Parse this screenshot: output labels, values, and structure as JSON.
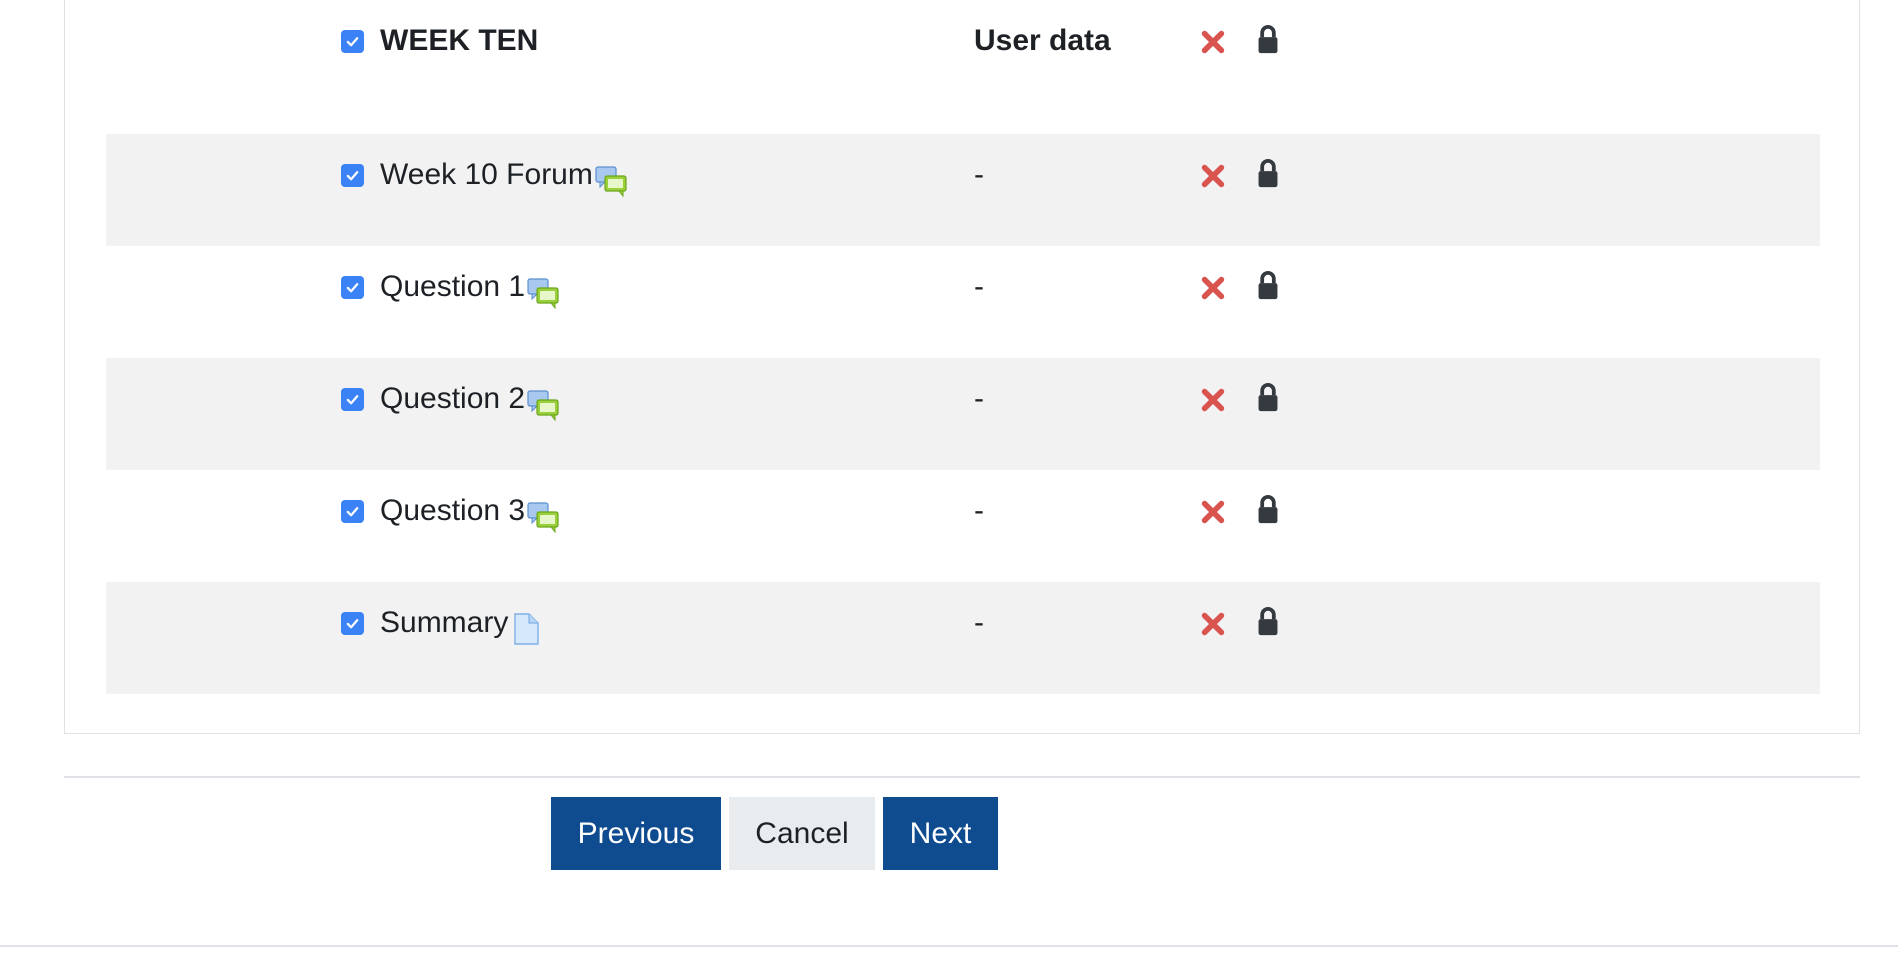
{
  "section": {
    "title": "WEEK TEN",
    "userdata_header": "User data",
    "checked": true
  },
  "activities": [
    {
      "name": "Week 10 Forum",
      "icon": "forum-icon",
      "userdata": "-",
      "checked": true
    },
    {
      "name": "Question 1",
      "icon": "forum-icon",
      "userdata": "-",
      "checked": true
    },
    {
      "name": "Question 2",
      "icon": "forum-icon",
      "userdata": "-",
      "checked": true
    },
    {
      "name": "Question 3",
      "icon": "forum-icon",
      "userdata": "-",
      "checked": true
    },
    {
      "name": "Summary",
      "icon": "page-icon",
      "userdata": "-",
      "checked": true
    }
  ],
  "status_icons": {
    "cross": "x-mark-icon",
    "lock": "lock-icon"
  },
  "buttons": {
    "previous": "Previous",
    "cancel": "Cancel",
    "next": "Next"
  },
  "colors": {
    "checkbox": "#3b82f6",
    "cross": "#d9534f",
    "lock": "#343a40",
    "primary_button": "#0f4c8f",
    "secondary_button": "#e9ecef",
    "row_shade": "#f2f2f2"
  }
}
